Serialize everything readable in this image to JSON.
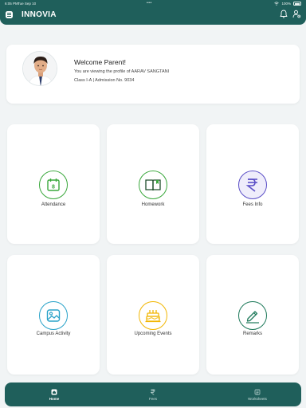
{
  "status_bar": {
    "time": "6:05 PM",
    "date": "Tue Sep 10",
    "battery_percent": "100%"
  },
  "header": {
    "title": "INNOVIA"
  },
  "welcome": {
    "title": "Welcome Parent!",
    "subtitle": "You are viewing the profile of AARAV SANGTANI",
    "class_info": "Class I-A | Admission No. 9034"
  },
  "tiles": [
    {
      "label": "Attendance",
      "icon": "calendar-icon",
      "color": "#3aa83c"
    },
    {
      "label": "Homework",
      "icon": "book-icon",
      "color": "#3aa83c"
    },
    {
      "label": "Fees Info",
      "icon": "rupee-icon",
      "color": "#5b4fc7"
    },
    {
      "label": "Campus Activity",
      "icon": "image-icon",
      "color": "#2aa3c9"
    },
    {
      "label": "Upcoming Events",
      "icon": "cake-icon",
      "color": "#f2b705"
    },
    {
      "label": "Remarks",
      "icon": "pen-icon",
      "color": "#1f7a5b"
    }
  ],
  "bottom_nav": [
    {
      "label": "Home",
      "icon": "home-icon",
      "active": true
    },
    {
      "label": "Fees",
      "icon": "rupee-icon",
      "active": false
    },
    {
      "label": "Worksheets",
      "icon": "worksheet-icon",
      "active": false
    }
  ],
  "colors": {
    "brand": "#1f5f5b",
    "background": "#f1f4f5"
  }
}
